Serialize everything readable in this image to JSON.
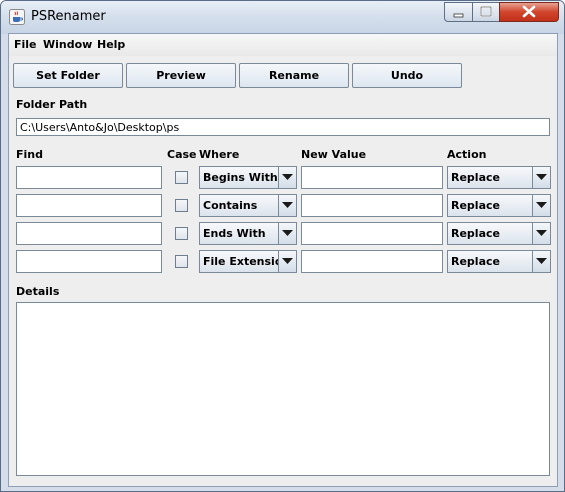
{
  "window": {
    "title": "PSRenamer"
  },
  "menu": [
    "File",
    "Window",
    "Help"
  ],
  "toolbar": {
    "set_folder": "Set Folder",
    "preview": "Preview",
    "rename": "Rename",
    "undo": "Undo"
  },
  "folder": {
    "label": "Folder Path",
    "value": "C:\\Users\\Anto&Jo\\Desktop\\ps"
  },
  "columns": {
    "find": "Find",
    "case": "Case",
    "where": "Where",
    "new_value": "New Value",
    "action": "Action"
  },
  "rules": [
    {
      "find": "",
      "case": false,
      "where": "Begins With",
      "new_value": "",
      "action": "Replace"
    },
    {
      "find": "",
      "case": false,
      "where": "Contains",
      "new_value": "",
      "action": "Replace"
    },
    {
      "find": "",
      "case": false,
      "where": "Ends With",
      "new_value": "",
      "action": "Replace"
    },
    {
      "find": "",
      "case": false,
      "where": "File Extension",
      "new_value": "",
      "action": "Replace"
    }
  ],
  "details": {
    "label": "Details",
    "text": ""
  }
}
